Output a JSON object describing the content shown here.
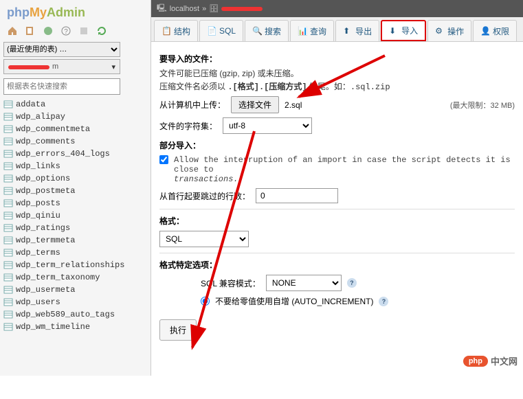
{
  "sidebar": {
    "logo": {
      "php": "php",
      "my": "My",
      "admin": "Admin"
    },
    "recent_select": "(最近使用的表) …",
    "db_tail": "m",
    "filter_placeholder": "根据表名快速搜索",
    "tables": [
      "addata",
      "wdp_alipay",
      "wdp_commentmeta",
      "wdp_comments",
      "wdp_errors_404_logs",
      "wdp_links",
      "wdp_options",
      "wdp_postmeta",
      "wdp_posts",
      "wdp_qiniu",
      "wdp_ratings",
      "wdp_termmeta",
      "wdp_terms",
      "wdp_term_relationships",
      "wdp_term_taxonomy",
      "wdp_usermeta",
      "wdp_users",
      "wdp_web589_auto_tags",
      "wdp_wm_timeline"
    ]
  },
  "breadcrumb": {
    "host": "localhost",
    "sep": "»"
  },
  "tabs": [
    {
      "label": "结构"
    },
    {
      "label": "SQL"
    },
    {
      "label": "搜索"
    },
    {
      "label": "查询"
    },
    {
      "label": "导出"
    },
    {
      "label": "导入"
    },
    {
      "label": "操作"
    },
    {
      "label": "权限"
    }
  ],
  "import": {
    "heading": "要导入的文件：",
    "hint1": "文件可能已压缩 (gzip, zip) 或未压缩。",
    "hint2_a": "压缩文件名必须以 ",
    "hint2_b": ".[格式].[压缩方式]",
    "hint2_c": " 结尾。如：",
    "hint2_d": ".sql.zip",
    "upload_label": "从计算机中上传：",
    "choose_btn": "选择文件",
    "filename": "2.sql",
    "max_limit": "(最大限制：32 MB)",
    "charset_label": "文件的字符集：",
    "charset_value": "utf-8",
    "partial_heading": "部分导入：",
    "allow_interrupt": "Allow the interruption of an import in case the script detects it is close to",
    "transactions": "transactions.)",
    "skip_label": "从首行起要跳过的行数：",
    "skip_value": "0",
    "format_heading": "格式：",
    "format_value": "SQL",
    "format_opts_heading": "格式特定选项：",
    "compat_label": "SQL 兼容模式：",
    "compat_value": "NONE",
    "auto_inc": "不要给零值使用自增 (AUTO_INCREMENT)",
    "submit": "执行"
  },
  "watermark": {
    "logo": "php",
    "text": "中文网"
  }
}
